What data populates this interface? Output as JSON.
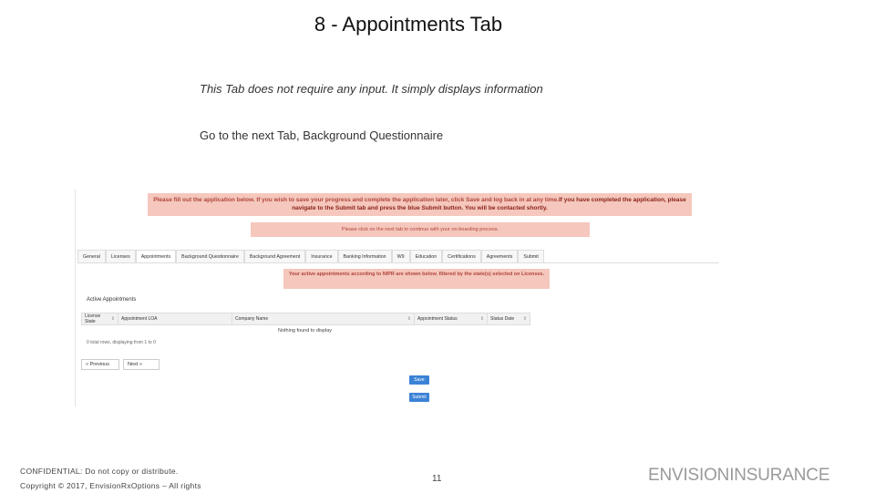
{
  "slide": {
    "title": "8 - Appointments Tab",
    "note_1": "This Tab does not require any input. It simply displays information",
    "note_2": "Go to the next Tab, Background Questionnaire"
  },
  "app": {
    "banner_part1": "Please fill out the application below. If you wish to save your progress and complete the application later, click Save and log back in at any time.",
    "banner_part2": "If you have completed the application, please navigate to the Submit tab and press the blue Submit button. You will be contacted shortly.",
    "hint": "Please click on the next tab to continue with your on-boarding process.",
    "tabs": [
      {
        "label": "General"
      },
      {
        "label": "Licenses"
      },
      {
        "label": "Appointments"
      },
      {
        "label": "Background Questionnaire"
      },
      {
        "label": "Background Agreement"
      },
      {
        "label": "Insurance"
      },
      {
        "label": "Banking Information"
      },
      {
        "label": "W9"
      },
      {
        "label": "Education"
      },
      {
        "label": "Certifications"
      },
      {
        "label": "Agreements"
      },
      {
        "label": "Submit"
      }
    ],
    "active_tab": "Appointments",
    "info_message": "Your active appointments according to NIPR are shown below. filtered by the state(s) selected on Licenses.",
    "section_title": "Active Appointments",
    "table": {
      "headers": [
        "License State",
        "Appointment LOA",
        "Company Name",
        "Appointment Status",
        "Status Date"
      ],
      "empty_message": "Nothing found to display",
      "count_text": "0 total rows, displaying from 1 to 0"
    },
    "pager": {
      "previous": "« Previous",
      "next": "Next »"
    },
    "buttons": {
      "save": "Save",
      "submit": "Submit"
    }
  },
  "footer": {
    "confidential": "CONFIDENTIAL: Do not copy or distribute.",
    "copyright": "Copyright © 2017, EnvisionRxOptions – All rights",
    "page_number": "11",
    "brand": "ENVISIONINSURANCE"
  },
  "colors": {
    "alert_bg": "#f5c7bd",
    "alert_text": "#b0453a",
    "button_blue": "#3b82d6"
  }
}
